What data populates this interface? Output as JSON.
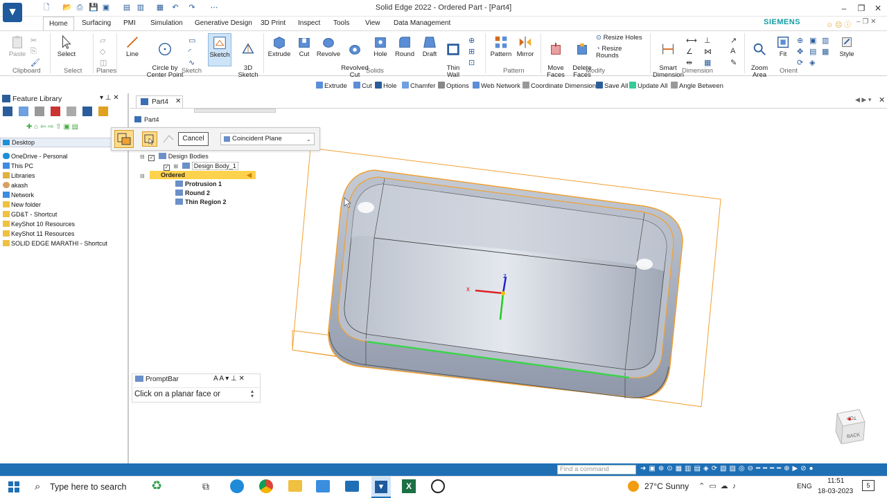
{
  "window": {
    "title": "Solid Edge 2022 - Ordered Part - [Part4]",
    "min": "–",
    "restore": "❐",
    "close": "✕",
    "brand": "SIEMENS"
  },
  "tabs": [
    "Home",
    "Surfacing",
    "PMI",
    "Simulation",
    "Generative Design",
    "3D Print",
    "Inspect",
    "Tools",
    "View",
    "Data Management"
  ],
  "ribbon": {
    "paste": "Paste",
    "select": "Select",
    "line": "Line",
    "circle": "Circle by\nCenter Point",
    "sketch": "Sketch",
    "sketch3d": "3D\nSketch",
    "extrude": "Extrude",
    "cut": "Cut",
    "revolve": "Revolve",
    "revolved_cut": "Revolved\nCut",
    "hole": "Hole",
    "round": "Round",
    "draft": "Draft",
    "thin_wall": "Thin\nWall",
    "pattern": "Pattern",
    "mirror": "Mirror",
    "move_faces": "Move\nFaces",
    "delete_faces": "Delete\nFaces",
    "resize_holes": "Resize Holes",
    "resize_rounds": "Resize Rounds",
    "smart_dimension": "Smart\nDimension",
    "zoom_area": "Zoom\nArea",
    "fit": "Fit",
    "style": "Style",
    "groups": [
      "Clipboard",
      "Select",
      "Planes",
      "Sketch",
      "Solids",
      "Pattern",
      "Modify",
      "Dimension",
      "Orient"
    ]
  },
  "command_bar": [
    "Extrude",
    "Cut",
    "Hole",
    "Chamfer",
    "Options",
    "Web Network",
    "Coordinate Dimension",
    "Save All",
    "Update All",
    "Angle Between"
  ],
  "feature_library": {
    "title": "Feature Library",
    "location": "Desktop",
    "items": [
      "OneDrive - Personal",
      "This PC",
      "Libraries",
      "akash",
      "Network",
      "New folder",
      "GD&T - Shortcut",
      "KeyShot 10 Resources",
      "KeyShot 11 Resources",
      "SOLID EDGE MARATHI - Shortcut"
    ]
  },
  "document": {
    "tab": "Part4",
    "tree_root": "Part4",
    "design_bodies": "Design Bodies",
    "design_body": "Design Body_1",
    "ordered": "Ordered",
    "features": [
      "Protrusion 1",
      "Round 2",
      "Thin Region 2"
    ]
  },
  "popup": {
    "cancel": "Cancel",
    "plane_option": "Coincident Plane"
  },
  "promptbar": {
    "title": "PromptBar",
    "text": "Click on a planar face or"
  },
  "viewport": {
    "axis_x": "x",
    "axis_z": "z",
    "cube_top": "TOP",
    "cube_back": "BACK"
  },
  "statusbar": {
    "find_placeholder": "Find a command"
  },
  "taskbar": {
    "search": "Type here to search",
    "weather": "27°C  Sunny",
    "lang": "ENG",
    "time": "11:51",
    "date": "18-03-2023",
    "notifications": "5"
  },
  "colors": {
    "accent": "#1f6fb5",
    "edge_highlight": "#f0a030",
    "selected_edge": "#3cd34a",
    "ordered_bg": "#ffd24d"
  }
}
